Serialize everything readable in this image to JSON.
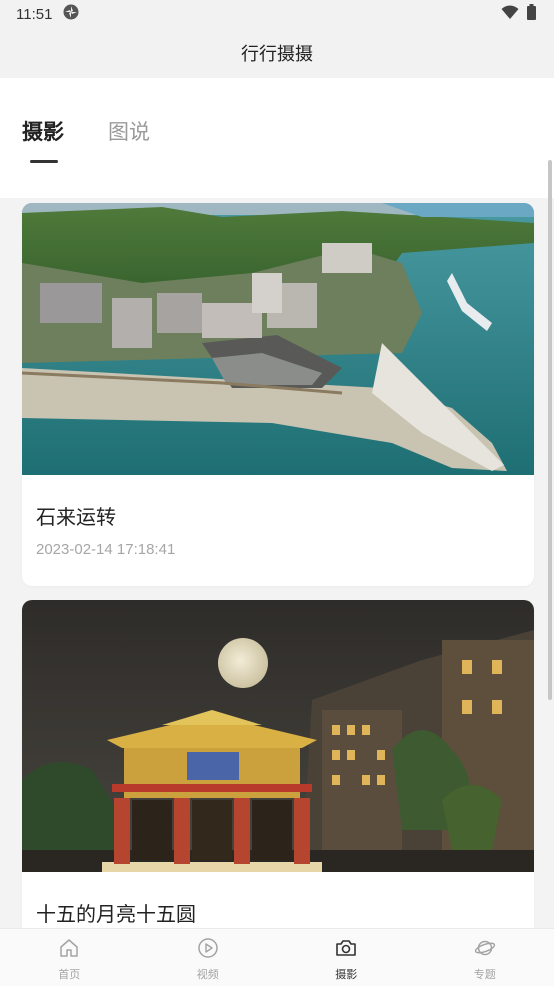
{
  "status_bar": {
    "time": "11:51"
  },
  "header": {
    "title": "行行摄摄"
  },
  "tabs": [
    {
      "label": "摄影",
      "active": true
    },
    {
      "label": "图说",
      "active": false
    }
  ],
  "posts": [
    {
      "title": "石来运转",
      "date": "2023-02-14 17:18:41"
    },
    {
      "title": "十五的月亮十五圆"
    }
  ],
  "tabbar": [
    {
      "label": "首页",
      "icon": "home-icon"
    },
    {
      "label": "视频",
      "icon": "play-icon"
    },
    {
      "label": "摄影",
      "icon": "camera-icon",
      "active": true
    },
    {
      "label": "专题",
      "icon": "planet-icon"
    }
  ],
  "colors": {
    "active_text": "#333333",
    "inactive_text": "#a3a3a3",
    "date_text": "#a6a6a6"
  }
}
